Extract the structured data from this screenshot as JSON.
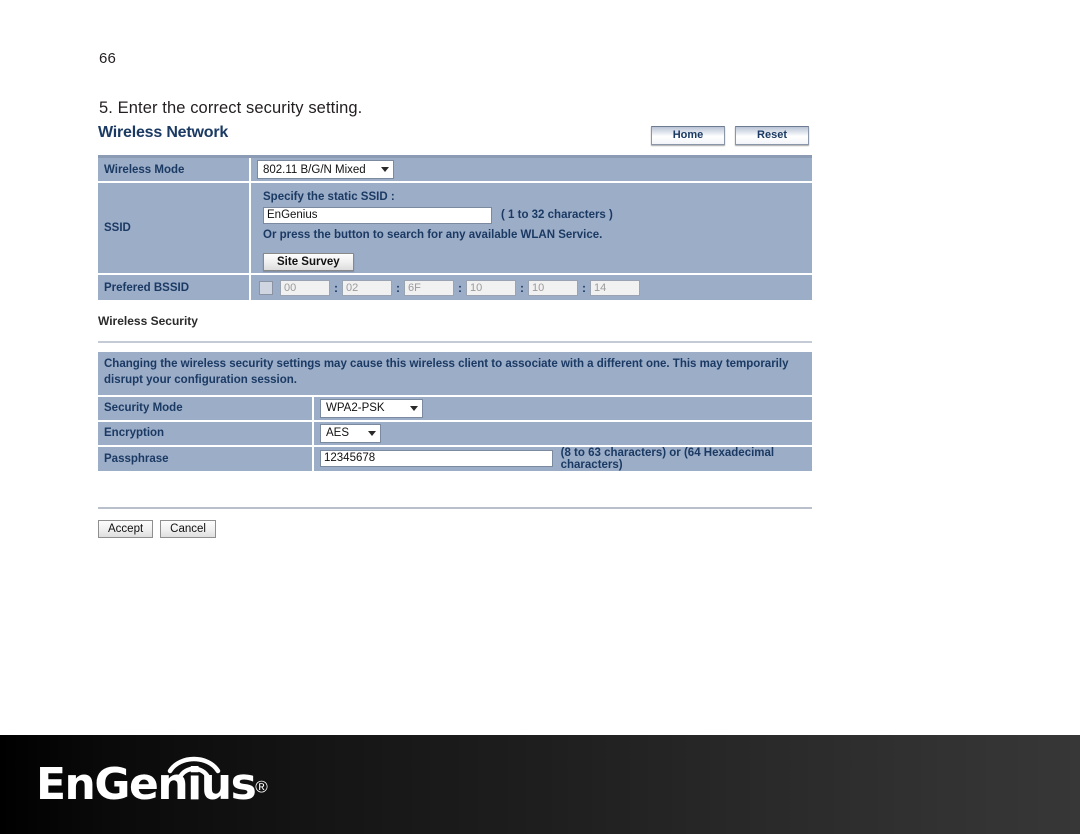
{
  "page": {
    "number": "66",
    "step_text": "5. Enter the correct security setting."
  },
  "router_ui": {
    "title": "Wireless Network",
    "header_buttons": [
      {
        "label": "Home",
        "name": "home-button"
      },
      {
        "label": "Reset",
        "name": "reset-button"
      }
    ],
    "wireless_mode": {
      "label": "Wireless Mode",
      "value": "802.11 B/G/N Mixed"
    },
    "ssid": {
      "label": "SSID",
      "specify_label": "Specify the static SSID  :",
      "value": "EnGenius",
      "placeholder": "",
      "char_hint": "( 1 to 32 characters )",
      "press_button_text": "Or press the button to search for any available WLAN Service.",
      "site_survey_label": "Site Survey"
    },
    "prefered_bssid": {
      "label": "Prefered BSSID",
      "enabled": false,
      "octets": [
        "00",
        "02",
        "6F",
        "10",
        "10",
        "14"
      ],
      "separator": ":"
    },
    "wireless_security": {
      "section_title": "Wireless Security",
      "warning": "Changing the wireless security settings may cause this wireless client to associate with a different one. This may temporarily disrupt your configuration session.",
      "security_mode": {
        "label": "Security Mode",
        "value": "WPA2-PSK"
      },
      "encryption": {
        "label": "Encryption",
        "value": "AES"
      },
      "passphrase": {
        "label": "Passphrase",
        "value": "12345678",
        "placeholder": "",
        "hint": "(8 to 63 characters) or (64 Hexadecimal characters)"
      }
    },
    "actions": [
      {
        "label": "Accept",
        "name": "accept-button"
      },
      {
        "label": "Cancel",
        "name": "cancel-button"
      }
    ]
  },
  "footer": {
    "brand": "EnGenius",
    "registered_mark": "®"
  },
  "colors": {
    "table_cell": "#9cadc8",
    "label_text": "#1b3a63",
    "footer_start": "#000000",
    "footer_end": "#373737"
  }
}
